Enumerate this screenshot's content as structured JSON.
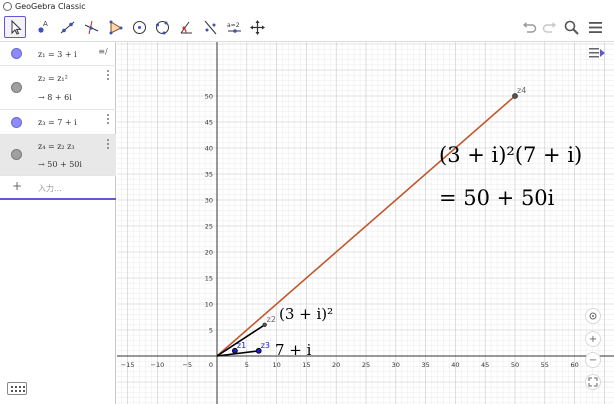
{
  "window": {
    "title": "GeoGebra Classic"
  },
  "toolbar": {
    "tools": [
      {
        "name": "move-tool",
        "selected": true
      },
      {
        "name": "point-tool"
      },
      {
        "name": "line-tool"
      },
      {
        "name": "perpendicular-line-tool"
      },
      {
        "name": "polygon-tool"
      },
      {
        "name": "circle-center-point-tool"
      },
      {
        "name": "circle-three-points-tool"
      },
      {
        "name": "angle-tool"
      },
      {
        "name": "reflect-tool"
      },
      {
        "name": "slider-tool",
        "label": "a=2"
      },
      {
        "name": "move-graphics-tool"
      }
    ],
    "right": [
      "undo-icon",
      "redo-icon",
      "search-icon",
      "menu-icon"
    ]
  },
  "algebra": {
    "items": [
      {
        "expr": "z₁ = 3 + i",
        "result": "",
        "color": "#8c8cff"
      },
      {
        "expr": "z₂ = z₁²",
        "result": "→  8 + 6i",
        "color": "#a0a0a0"
      },
      {
        "expr": "z₃ = 7 + i",
        "result": "",
        "color": "#8c8cff"
      },
      {
        "expr": "z₄ = z₂ z₃",
        "result": "→  50 + 50i",
        "color": "#a0a0a0"
      }
    ],
    "input_placeholder": "入力..."
  },
  "graph": {
    "x_ticks": [
      "−15",
      "−10",
      "−5",
      "0",
      "5",
      "10",
      "15",
      "20",
      "25",
      "30",
      "35",
      "40",
      "45",
      "50",
      "55",
      "60"
    ],
    "y_ticks": [
      "5",
      "10",
      "15",
      "20",
      "25",
      "30",
      "35",
      "40",
      "45",
      "50"
    ],
    "point_labels": {
      "z1": "z1",
      "z2": "z2",
      "z3": "z3",
      "z4": "z4"
    },
    "text_labels": {
      "z2_label": "(3 + i)²",
      "z3_label": "7 + i",
      "equation_line1": "(3 + i)²(7 + i)",
      "equation_line2": "= 50 + 50i"
    },
    "points": {
      "z1": [
        3,
        1
      ],
      "z2": [
        8,
        6
      ],
      "z3": [
        7,
        1
      ],
      "z4": [
        50,
        50
      ]
    },
    "colors": {
      "segment_z4": "#c0582d",
      "segment": "#000000",
      "point_blue": "#1a1ad6"
    }
  }
}
